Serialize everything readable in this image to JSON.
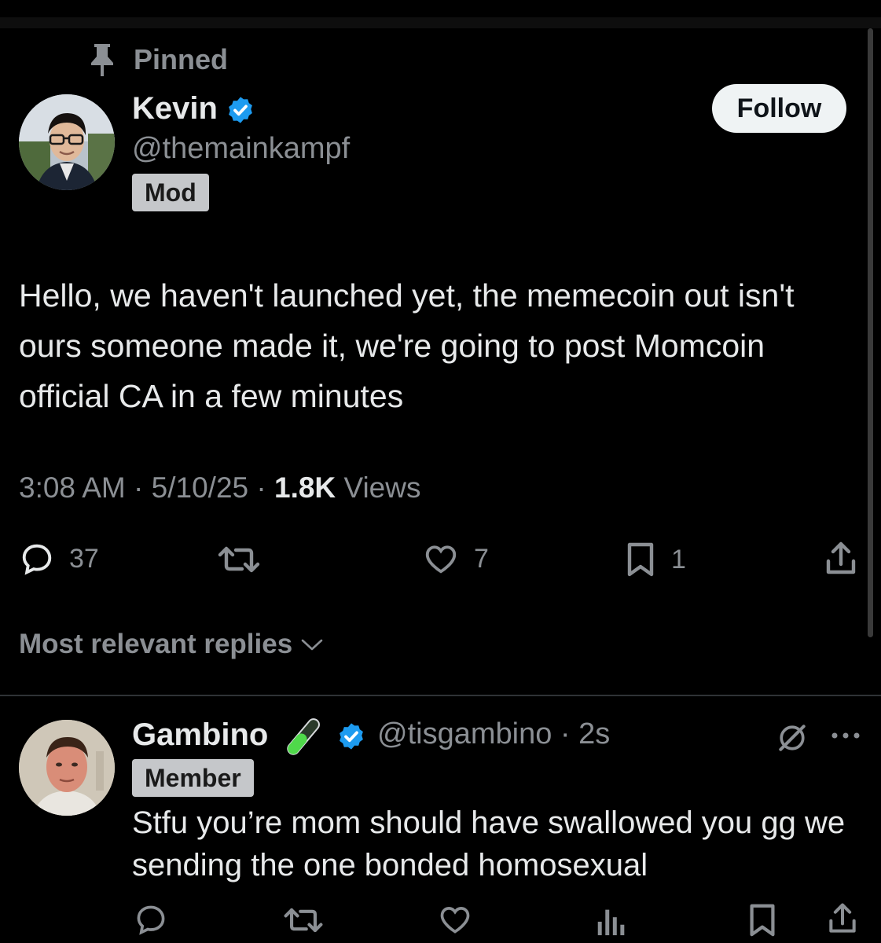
{
  "pinned": {
    "label": "Pinned"
  },
  "post": {
    "author_name": "Kevin",
    "author_handle": "@themainkampf",
    "role_badge": "Mod",
    "follow_label": "Follow",
    "text": "Hello, we haven't launched yet, the memecoin out isn't ours someone made it, we're going to post Momcoin official CA in a few minutes",
    "time": "3:08 AM",
    "date": "5/10/25",
    "views_count": "1.8K",
    "views_label": "Views",
    "separator": "·",
    "replies": "37",
    "likes": "7",
    "bookmarks": "1"
  },
  "sort": {
    "label": "Most relevant replies"
  },
  "reply": {
    "author_name": "Gambino",
    "author_handle": "@tisgambino · 2s",
    "role_badge": "Member",
    "text": "Stfu you’re mom should have swallowed you gg we sending the one bonded homosexual"
  },
  "colors": {
    "background": "#000000",
    "text_primary": "#e7e9ea",
    "text_secondary": "#8b8f94",
    "verified_blue": "#1d9bf0",
    "divider": "#2f3336"
  },
  "icons": [
    "pin-icon",
    "verified-badge-icon",
    "reply-icon",
    "retweet-icon",
    "like-icon",
    "bookmark-icon",
    "share-icon",
    "chevron-down-icon",
    "test-tube-icon",
    "grok-icon",
    "more-icon",
    "views-icon"
  ]
}
